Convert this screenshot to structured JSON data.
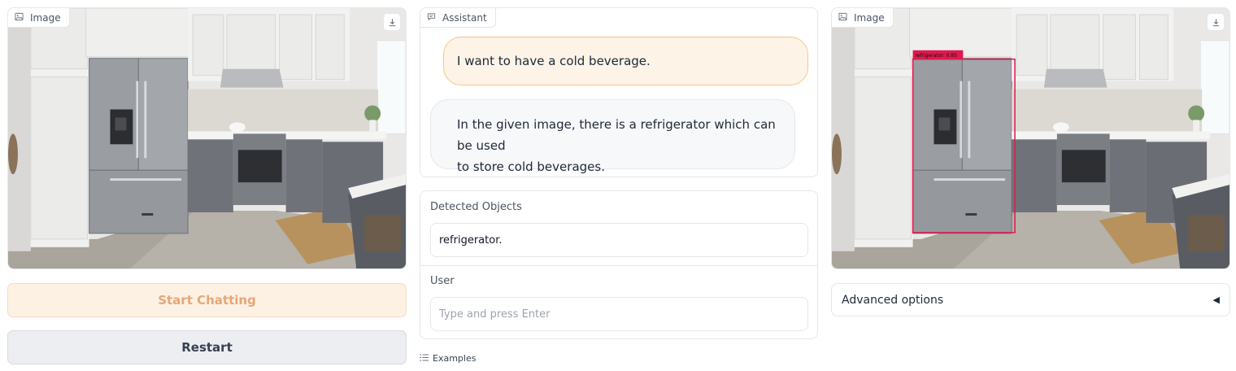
{
  "left_image": {
    "label": "Image"
  },
  "right_image": {
    "label": "Image",
    "detection_label": "refrigerator: 0.85"
  },
  "chat": {
    "label": "Assistant",
    "messages": [
      {
        "role": "user",
        "text": "I want to have a cold beverage."
      },
      {
        "role": "assistant",
        "line1": "In the given image, there is a refrigerator which can be used",
        "line2": "to store cold beverages."
      }
    ]
  },
  "detected": {
    "label": "Detected Objects",
    "value": "refrigerator."
  },
  "user_input": {
    "label": "User",
    "placeholder": "Type and press Enter"
  },
  "buttons": {
    "start": "Start Chatting",
    "restart": "Restart"
  },
  "examples": {
    "label": "Examples"
  },
  "advanced": {
    "label": "Advanced options",
    "arrow": "◀"
  },
  "colors": {
    "accent": "#f5c68f",
    "box": "#e0194f"
  },
  "icons": [
    "image-icon",
    "download-icon",
    "chat-icon",
    "list-icon"
  ]
}
